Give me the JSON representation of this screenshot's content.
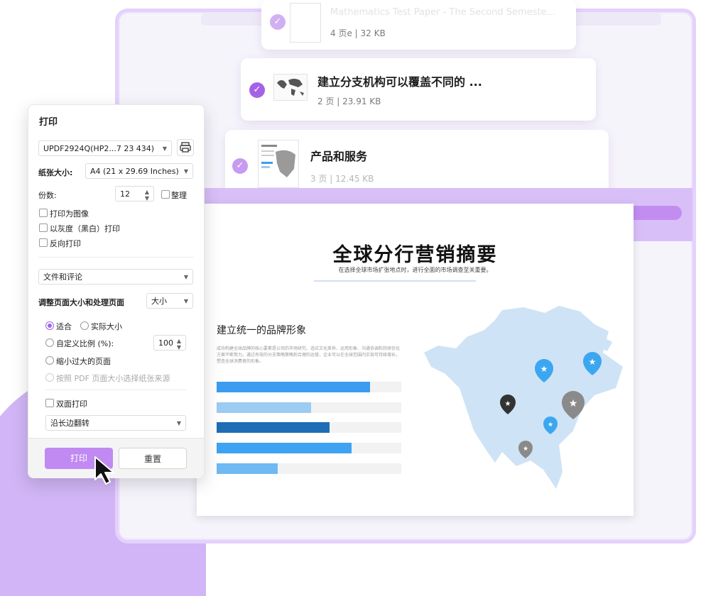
{
  "colors": {
    "accent": "#a463e6",
    "bar1": "#3b9cf0",
    "bar2": "#9ccbf3",
    "bar3": "#1f6db5",
    "bar4": "#3ea3f2",
    "bar5": "#6fb9f5",
    "map": "#cfe3f6",
    "pin_blue": "#3ca7f0",
    "pin_dark": "#333333",
    "pin_gray": "#8a8a8a"
  },
  "files": [
    {
      "title": "Mathematics Test Paper - The Second Semeste...",
      "pages": "4 页e",
      "size": "32 KB"
    },
    {
      "title": "建立分支机构可以覆盖不同的 ...",
      "pages": "2 页",
      "size": "23.91 KB"
    },
    {
      "title": "产品和服务",
      "pages": "3 页",
      "size": "12.45 KB"
    }
  ],
  "document": {
    "title": "全球分行营销摘要",
    "subtitle": "在选择全球市场扩张地点时，进行全面的市场调查至关重要。",
    "section_title": "建立统一的品牌形象",
    "section_text": "成功构建全球品牌的核心要素是公司的市场研究、适应文化差异、运用形象、沟通协调和持续优化方面不断努力。通过有效的分支策略策略和合理的运营，企业可以在全球范围内实现可持续增长，塑造全球消费者的形象。",
    "bars": [
      0.83,
      0.51,
      0.61,
      0.73,
      0.33
    ]
  },
  "print_dialog": {
    "title": "打印",
    "printer": "UPDF2924Q(HP2...7 23 434)",
    "paper_size_label": "纸张大小:",
    "paper_size_value": "A4 (21 x 29.69 Inches)",
    "copies_label": "份数:",
    "copies_value": "12",
    "collate_label": "整理",
    "print_as_image": "打印为图像",
    "grayscale": "以灰度（黑白）打印",
    "reverse": "反向打印",
    "content_value": "文件和评论",
    "page_sizing_label": "调整页面大小和处理页面",
    "page_sizing_value": "大小",
    "fit": "适合",
    "actual_size": "实际大小",
    "custom_scale": "自定义比例 (%):",
    "custom_scale_value": "100",
    "shrink": "缩小过大的页面",
    "choose_by_pdf": "按照 PDF 页面大小选择纸张来源",
    "duplex": "双面打印",
    "flip_value": "沿长边翻转",
    "print_button": "打印",
    "reset_button": "重置"
  }
}
